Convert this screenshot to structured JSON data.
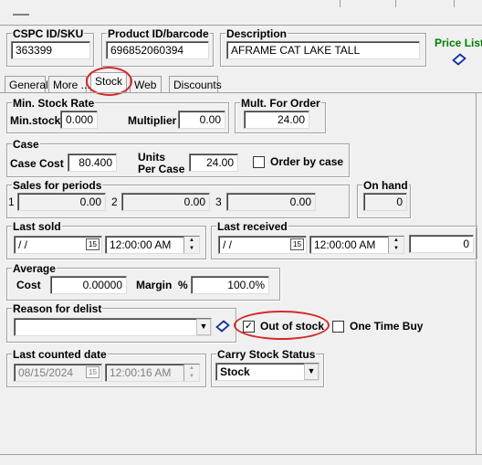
{
  "header": {
    "sku_label": "CSPC ID/SKU",
    "sku_value": "363399",
    "product_label": "Product ID/barcode",
    "product_value": "696852060394",
    "description_label": "Description",
    "description_value": "AFRAME CAT LAKE TALL",
    "price_list_link": "Price List",
    "price_list_color": "#008000"
  },
  "tabs": [
    {
      "label": "General"
    },
    {
      "label": "More ..."
    },
    {
      "label": "Stock",
      "active": true
    },
    {
      "label": "Web"
    },
    {
      "label": "Discounts"
    }
  ],
  "min_stock": {
    "group_label": "Min. Stock Rate",
    "min_stock_label": "Min.stock",
    "min_stock_value": "0.000",
    "multiplier_label": "Multiplier",
    "multiplier_value": "0.00"
  },
  "mult_order": {
    "group_label": "Mult. For Order",
    "value": "24.00"
  },
  "case": {
    "group_label": "Case",
    "case_cost_label": "Case Cost",
    "case_cost_value": "80.400",
    "units_label_1": "Units",
    "units_label_2": "Per Case",
    "units_value": "24.00",
    "order_by_case_label": "Order by case",
    "order_by_case_checked": false
  },
  "sales": {
    "group_label": "Sales for periods",
    "periods": [
      {
        "index": "1",
        "value": "0.00"
      },
      {
        "index": "2",
        "value": "0.00"
      },
      {
        "index": "3",
        "value": "0.00"
      }
    ]
  },
  "on_hand": {
    "group_label": "On hand",
    "value": "0"
  },
  "last_sold": {
    "group_label": "Last sold",
    "date_value": " / /",
    "time_value": "12:00:00 AM"
  },
  "last_received": {
    "group_label": "Last received",
    "date_value": " / /",
    "time_value": "12:00:00 AM",
    "qty_value": "0"
  },
  "average": {
    "group_label": "Average",
    "cost_label": "Cost",
    "cost_value": "0.00000",
    "margin_label": "Margin",
    "percent_symbol": "%",
    "margin_value": "100.0%"
  },
  "delist": {
    "group_label": "Reason for delist",
    "value": ""
  },
  "out_of_stock": {
    "label": "Out of stock",
    "checked": true
  },
  "one_time_buy": {
    "label": "One Time Buy",
    "checked": false
  },
  "last_counted": {
    "group_label": "Last counted date",
    "date_value": "08/15/2024",
    "time_value": "12:00:16 AM"
  },
  "carry_status": {
    "group_label": "Carry Stock Status",
    "value": "Stock"
  },
  "calendar_glyph": "15",
  "highlight_color": "#d32a2a"
}
